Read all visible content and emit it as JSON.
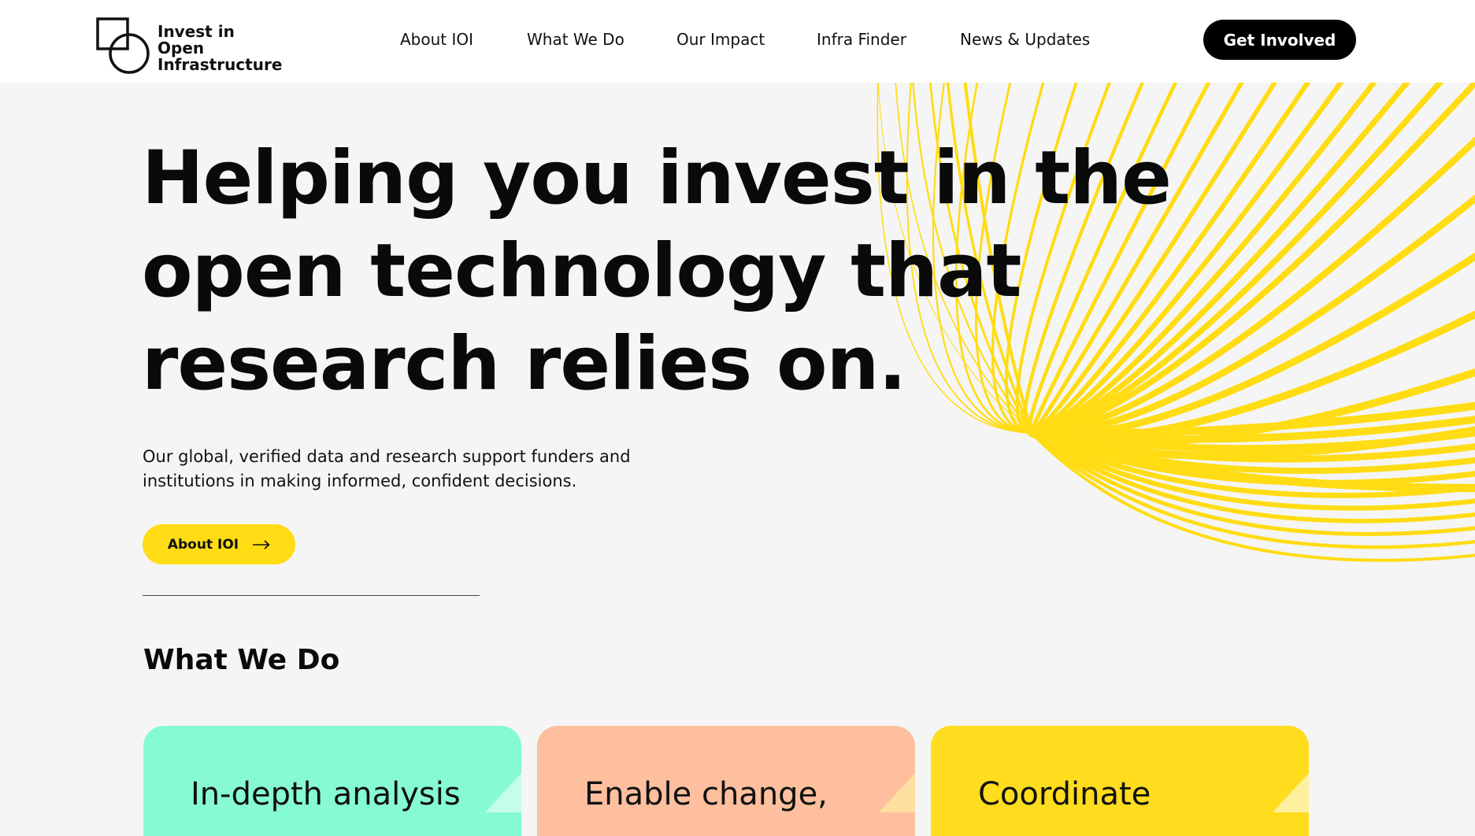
{
  "brand": {
    "name_line1": "Invest in Open",
    "name_line2": "Infrastructure"
  },
  "nav": {
    "items": [
      {
        "label": "About IOI"
      },
      {
        "label": "What We Do"
      },
      {
        "label": "Our Impact"
      },
      {
        "label": "Infra Finder"
      },
      {
        "label": "News & Updates"
      }
    ],
    "cta_label": "Get Involved"
  },
  "hero": {
    "title_lines": [
      "Helping you invest in the",
      "open technology that",
      "research relies on."
    ],
    "description_lines": [
      "Our global, verified data and research support funders and",
      "institutions in making informed, confident decisions."
    ],
    "button_label": "About IOI"
  },
  "what_we_do": {
    "title": "What We Do",
    "cards": [
      {
        "title": "In-depth analysis",
        "color": "#86fbd2",
        "corner_color": "#c4fde9"
      },
      {
        "title": "Enable change,",
        "color": "#fdbf9e",
        "corner_color": "#fedfa0"
      },
      {
        "title": "Coordinate",
        "color": "#ffdc1e",
        "corner_color": "#fff0a0"
      }
    ]
  },
  "theme": {
    "accent": "#ffdc13",
    "background": "#f5f5f5",
    "header_bg": "#ffffff",
    "cta_bg": "#000000"
  }
}
